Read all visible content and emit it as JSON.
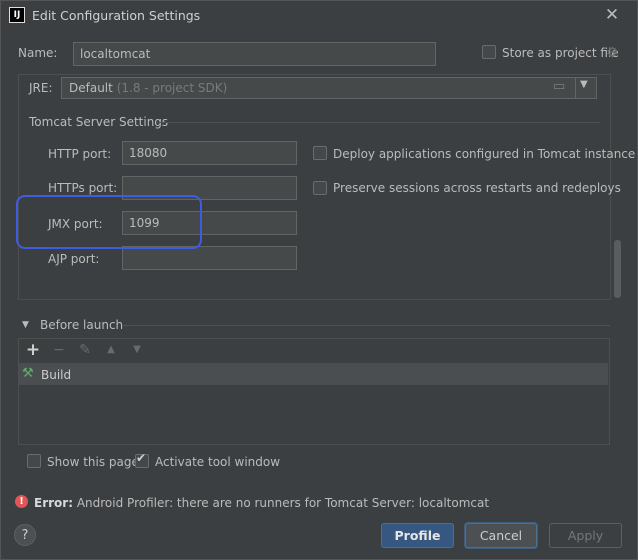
{
  "window": {
    "title": "Edit Configuration Settings",
    "app_icon_text": "IJ"
  },
  "name_row": {
    "label": "Name:",
    "value": "localtomcat",
    "store_label": "Store as project file",
    "store_checked": false
  },
  "jre": {
    "label": "JRE:",
    "value": "Default",
    "detail": "(1.8 - project SDK)"
  },
  "tomcat": {
    "section_title": "Tomcat Server Settings",
    "http_label": "HTTP port:",
    "http_value": "18080",
    "https_label": "HTTPs port:",
    "https_value": "",
    "jmx_label": "JMX port:",
    "jmx_value": "1099",
    "ajp_label": "AJP port:",
    "ajp_value": "",
    "deploy_label": "Deploy applications configured in Tomcat instance",
    "deploy_checked": false,
    "preserve_label": "Preserve sessions across restarts and redeploys",
    "preserve_checked": false
  },
  "before_launch": {
    "title": "Before launch",
    "toolbar": {
      "add": "+",
      "remove": "−",
      "edit": "✎",
      "up": "▲",
      "down": "▼"
    },
    "items": [
      {
        "label": "Build",
        "icon": "hammer-icon"
      }
    ]
  },
  "options": {
    "show_page_label": "Show this page",
    "show_page_checked": false,
    "tool_window_label": "Activate tool window",
    "tool_window_checked": true
  },
  "error": {
    "prefix": "Error:",
    "message": "Android Profiler: there are no runners for Tomcat Server: localtomcat"
  },
  "footer": {
    "help": "?",
    "profile": "Profile",
    "cancel": "Cancel",
    "apply": "Apply"
  },
  "colors": {
    "accent": "#365880",
    "highlight": "#3d5ce0",
    "error": "#e05555",
    "background": "#3c3f41"
  }
}
